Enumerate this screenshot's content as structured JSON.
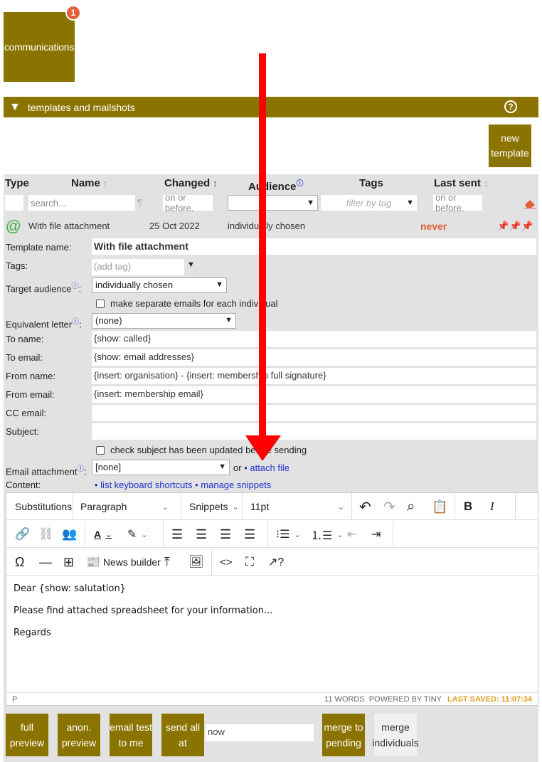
{
  "top": {
    "tile_label": "communications",
    "badge": "1"
  },
  "section": {
    "title": "templates and mailshots",
    "help": "?",
    "new_template": "new template"
  },
  "columns": {
    "type": "Type",
    "name": "Name",
    "changed": "Changed",
    "audience": "Audience",
    "tags": "Tags",
    "last_sent": "Last sent"
  },
  "filters": {
    "search_placeholder": "search...",
    "changed_placeholder": "on or before.",
    "tags_placeholder": "filter by tag",
    "last_sent_placeholder": "on or before.",
    "paragraph_mark": "¶"
  },
  "row": {
    "name": "With file attachment",
    "changed": "25 Oct 2022",
    "audience": "individually chosen",
    "last_sent": "never"
  },
  "form": {
    "template_name_label": "Template name:",
    "template_name": "With file attachment",
    "tags_label": "Tags:",
    "tags_placeholder": "(add tag)",
    "target_audience_label": "Target audience",
    "target_audience": "individually chosen",
    "separate_emails": "make separate emails for each individual",
    "equivalent_letter_label": "Equivalent letter",
    "equivalent_letter": "(none)",
    "to_name_label": "To name:",
    "to_name": "{show: called}",
    "to_email_label": "To email:",
    "to_email": "{show: email addresses}",
    "from_name_label": "From name:",
    "from_name": "{insert: organisation} - {insert: membership full signature}",
    "from_email_label": "From email:",
    "from_email": "{insert: membership email}",
    "cc_email_label": "CC email:",
    "cc_email": "",
    "subject_label": "Subject:",
    "subject": "",
    "check_subject": "check subject has been updated before sending",
    "attachment_label": "Email attachment",
    "attachment": "[none]",
    "or": "or",
    "attach_file": "• attach file",
    "content_label": "Content:",
    "list_shortcuts": "• list keyboard shortcuts",
    "manage_snippets": "• manage snippets"
  },
  "editor": {
    "substitutions": "Substitutions",
    "paragraph": "Paragraph",
    "snippets": "Snippets",
    "font_size": "11pt",
    "bold": "B",
    "italic": "I",
    "news_builder": "News builder",
    "body": [
      "Dear {show: salutation}",
      "Please find attached spreadsheet for your information...",
      "Regards"
    ],
    "status_path": "P",
    "word_count": "11 WORDS",
    "powered": "POWERED BY TINY",
    "last_saved": "LAST SAVED: 11:07:34"
  },
  "buttons": {
    "full_preview": "full preview",
    "anon_preview": "anon. preview",
    "email_test": "email test to me",
    "send_all_at": "send all at",
    "send_time": "now",
    "merge_pending": "merge to pending",
    "merge_individuals": "merge individuals"
  },
  "colors": {
    "brand": "#8b7300",
    "accent": "#e0603a",
    "link": "#2233cc",
    "arrow": "#ff0000"
  }
}
